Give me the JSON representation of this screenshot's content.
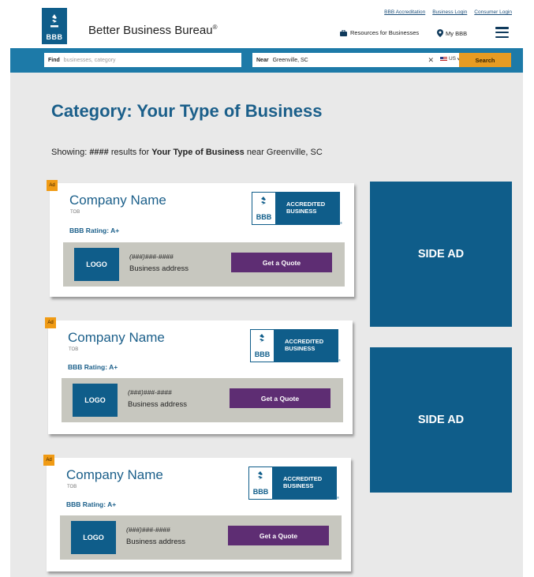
{
  "header": {
    "util_links": [
      "BBB Accreditation",
      "Business Login",
      "Consumer Login"
    ],
    "logo_text": "BBB",
    "brand": "Better Business Bureau",
    "brand_mark": "®",
    "resources_label": "Resources for Businesses",
    "mybbb_label": "My BBB"
  },
  "search": {
    "find_label": "Find",
    "find_placeholder": "businesses, category",
    "near_label": "Near",
    "near_value": "Greenville, SC",
    "clear_glyph": "✕",
    "country_value": "US",
    "button_label": "Search"
  },
  "main": {
    "title": "Category: Your Type of Business",
    "showing_prefix": "Showing: ",
    "showing_count": "####",
    "showing_mid": " results for ",
    "showing_category": "Your Type of Business",
    "showing_suffix": " near Greenville, SC"
  },
  "listings": [
    {
      "ad_label": "Ad",
      "company": "Company Name",
      "tob": "TOB",
      "rating": "BBB Rating: A+",
      "seal_text": "BBB",
      "accredited_line1": "ACCREDITED",
      "accredited_line2": "BUSINESS",
      "accredited_mark": "®",
      "logo": "LOGO",
      "phone": "(###)###-####",
      "address": "Business address",
      "quote_label": "Get a Quote"
    },
    {
      "ad_label": "Ad",
      "company": "Company Name",
      "tob": "TOB",
      "rating": "BBB Rating: A+",
      "seal_text": "BBB",
      "accredited_line1": "ACCREDITED",
      "accredited_line2": "BUSINESS",
      "accredited_mark": "®",
      "logo": "LOGO",
      "phone": "(###)###-####",
      "address": "Business address",
      "quote_label": "Get a Quote"
    },
    {
      "ad_label": "Ad",
      "company": "Company Name",
      "tob": "TOB",
      "rating": "BBB Rating: A+",
      "seal_text": "BBB",
      "accredited_line1": "ACCREDITED",
      "accredited_line2": "BUSINESS",
      "accredited_mark": "®",
      "logo": "LOGO",
      "phone": "(###)###-####",
      "address": "Business address",
      "quote_label": "Get a Quote"
    }
  ],
  "side_ads": [
    "SIDE AD",
    "SIDE AD"
  ],
  "colors": {
    "brand_blue": "#0f5d8a",
    "search_bar": "#1d7aa8",
    "search_button": "#e69b23",
    "quote_button": "#5e2d73",
    "ad_badge": "#f09b15"
  }
}
